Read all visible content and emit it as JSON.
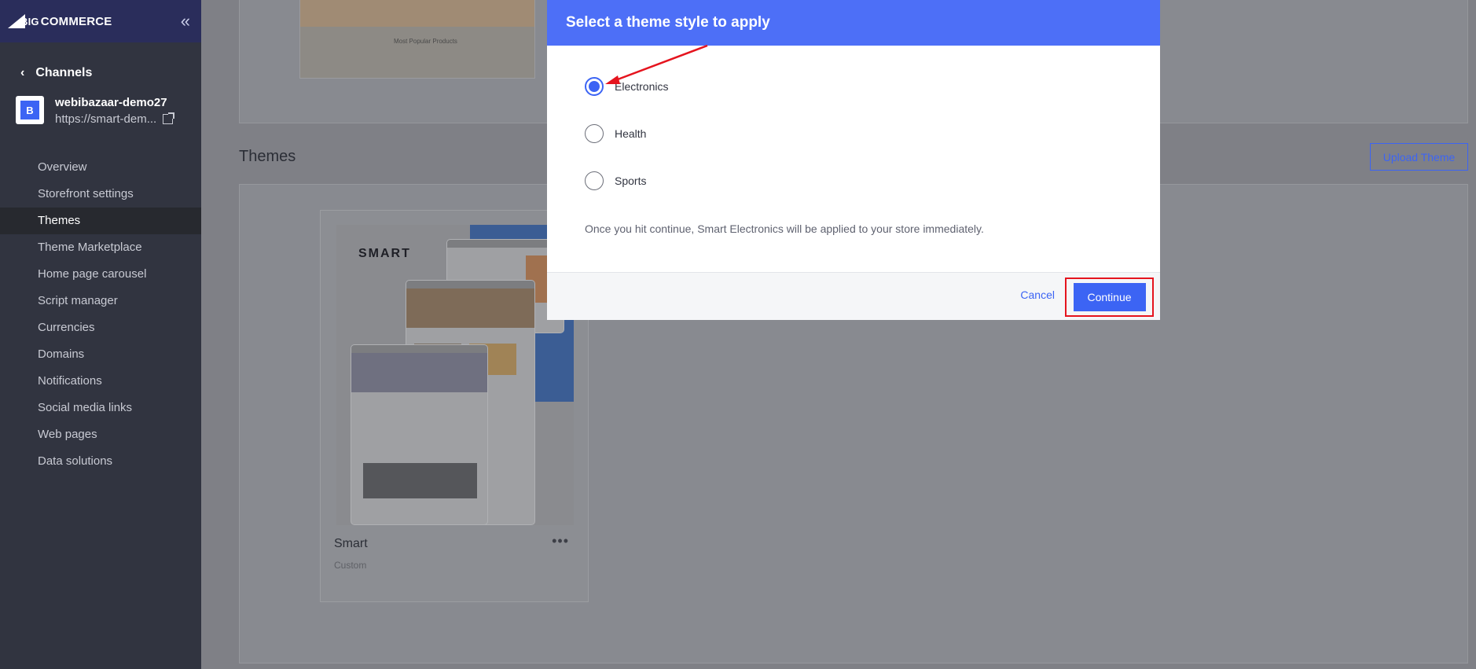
{
  "brand": {
    "big": "BIG",
    "commerce": "COMMERCE"
  },
  "sidebar": {
    "back_label": "Channels",
    "store_name": "webibazaar-demo27",
    "store_url": "https://smart-dem...",
    "store_avatar_letter": "B",
    "items": [
      {
        "label": "Overview"
      },
      {
        "label": "Storefront settings"
      },
      {
        "label": "Themes",
        "active": true
      },
      {
        "label": "Theme Marketplace"
      },
      {
        "label": "Home page carousel"
      },
      {
        "label": "Script manager"
      },
      {
        "label": "Currencies"
      },
      {
        "label": "Domains"
      },
      {
        "label": "Notifications"
      },
      {
        "label": "Social media links"
      },
      {
        "label": "Web pages"
      },
      {
        "label": "Data solutions"
      }
    ]
  },
  "main": {
    "top_caption": "Most Popular Products",
    "themes_title": "Themes",
    "upload_label": "Upload Theme",
    "theme": {
      "preview_word": "SMART",
      "name": "Smart",
      "tag": "Custom",
      "menu": "•••"
    }
  },
  "modal": {
    "title": "Select a theme style to apply",
    "options": [
      {
        "label": "Electronics",
        "checked": true
      },
      {
        "label": "Health",
        "checked": false
      },
      {
        "label": "Sports",
        "checked": false
      }
    ],
    "note": "Once you hit continue, Smart Electronics will be applied to your store immediately.",
    "cancel_label": "Cancel",
    "continue_label": "Continue"
  },
  "colors": {
    "accent": "#3c64f4",
    "modal_header": "#4d6ff7",
    "highlight": "#e5141e",
    "sidebar": "#313440"
  }
}
